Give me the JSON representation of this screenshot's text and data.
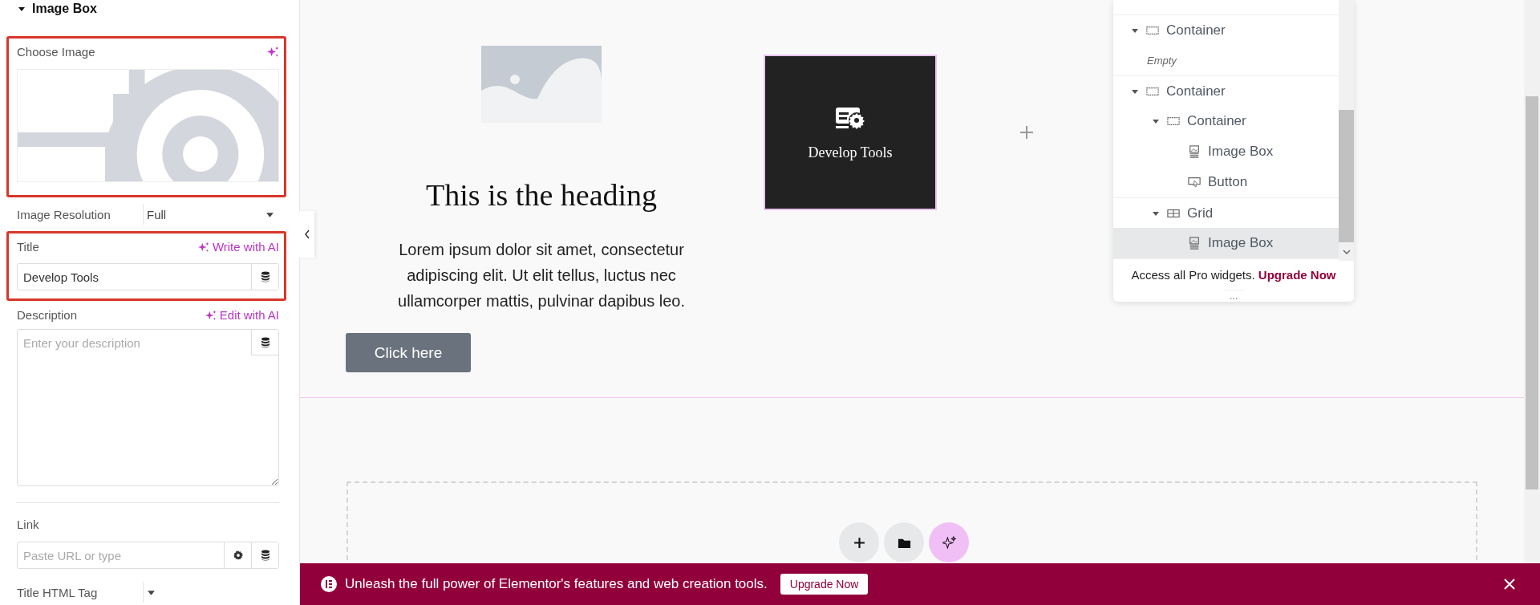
{
  "panel": {
    "section_title": "Image Box",
    "expanded": true,
    "choose_image": {
      "label": "Choose Image"
    },
    "image_resolution": {
      "label": "Image Resolution",
      "value": "Full"
    },
    "title": {
      "label": "Title",
      "ai_link": "Write with AI",
      "value": "Develop Tools"
    },
    "description": {
      "label": "Description",
      "ai_link": "Edit with AI",
      "placeholder": "Enter your description"
    },
    "link": {
      "label": "Link",
      "placeholder": "Paste URL or type"
    },
    "html_tag": {
      "label": "Title HTML Tag"
    }
  },
  "canvas": {
    "heading": "This is the heading",
    "paragraph": "Lorem ipsum dolor sit amet, consectetur adipiscing elit. Ut elit tellus, luctus nec ullamcorper mattis, pulvinar dapibus leo.",
    "button": "Click here",
    "card_title": "Develop Tools"
  },
  "navigator": {
    "items": [
      {
        "kind": "container",
        "label": "Container",
        "expanded": true,
        "selected": false,
        "children": [
          {
            "kind": "empty",
            "label": "Empty"
          }
        ]
      },
      {
        "kind": "container",
        "label": "Container",
        "expanded": true,
        "selected": false,
        "children": [
          {
            "kind": "container",
            "label": "Container",
            "expanded": true,
            "selected": false,
            "children": [
              {
                "kind": "image-box",
                "label": "Image Box",
                "selected": false
              },
              {
                "kind": "button",
                "label": "Button",
                "selected": false
              }
            ]
          },
          {
            "kind": "grid",
            "label": "Grid",
            "expanded": true,
            "selected": false,
            "children": [
              {
                "kind": "image-box",
                "label": "Image Box",
                "selected": true
              }
            ]
          }
        ]
      }
    ],
    "promo": "Access all Pro widgets.",
    "promo_link": "Upgrade Now",
    "more": "..."
  },
  "banner": {
    "text": "Unleash the full power of Elementor's features and web creation tools.",
    "button": "Upgrade Now"
  }
}
